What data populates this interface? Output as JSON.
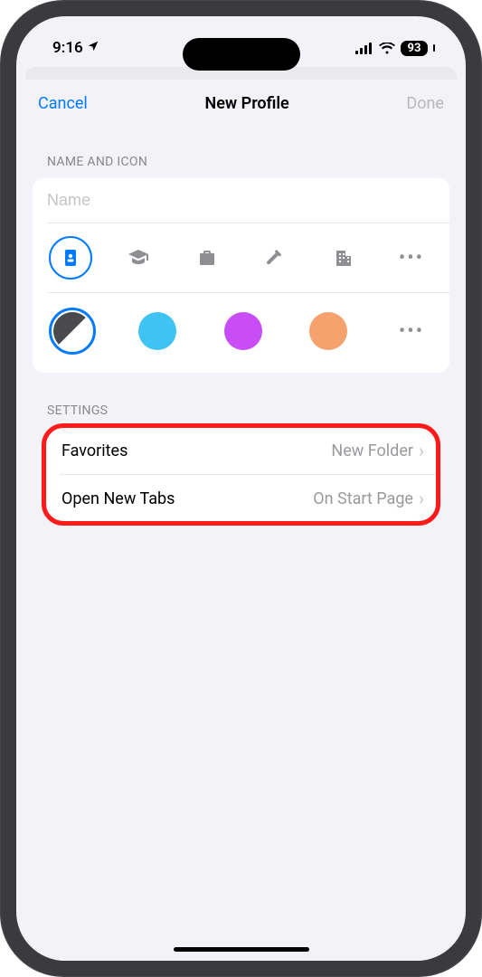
{
  "status": {
    "time": "9:16",
    "battery": "93"
  },
  "nav": {
    "cancel": "Cancel",
    "title": "New Profile",
    "done": "Done"
  },
  "sections": {
    "name_icon_header": "NAME AND ICON",
    "settings_header": "SETTINGS"
  },
  "name_field": {
    "placeholder": "Name",
    "value": ""
  },
  "icons": {
    "items": [
      "badge",
      "graduation-cap",
      "briefcase",
      "hammer",
      "building",
      "more"
    ],
    "selected_index": 0
  },
  "colors": {
    "swatches": [
      {
        "name": "split",
        "css": "split"
      },
      {
        "name": "blue",
        "hex": "#3fc3f3"
      },
      {
        "name": "purple",
        "hex": "#c84df6"
      },
      {
        "name": "orange",
        "hex": "#f6a26f"
      }
    ],
    "selected_index": 0
  },
  "settings_rows": [
    {
      "label": "Favorites",
      "value": "New Folder"
    },
    {
      "label": "Open New Tabs",
      "value": "On Start Page"
    }
  ]
}
